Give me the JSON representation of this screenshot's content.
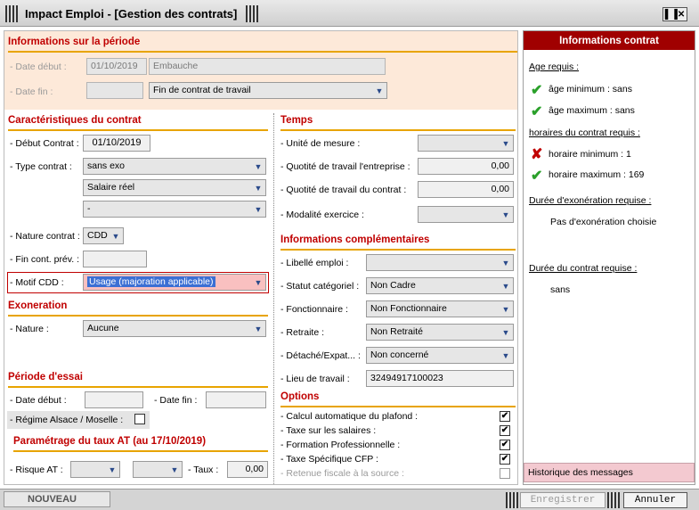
{
  "window": {
    "title": "Impact Emploi - [Gestion des contrats]"
  },
  "periode": {
    "title": "Informations sur la période",
    "date_debut_label": "- Date début :",
    "date_debut_value": "01/10/2019",
    "date_debut_reason": "Embauche",
    "date_fin_label": "- Date fin :",
    "date_fin_value": "",
    "date_fin_reason": "Fin de contrat de travail"
  },
  "caracteristiques": {
    "title": "Caractéristiques du contrat",
    "debut_label": "- Début Contrat :",
    "debut_value": "01/10/2019",
    "type_label": "- Type contrat :",
    "type_value": "sans exo",
    "type_value2": "Salaire réel",
    "type_value3": "-",
    "nature_label": "- Nature contrat :",
    "nature_value": "CDD",
    "fin_prev_label": "- Fin cont. prév. :",
    "fin_prev_value": "",
    "motif_label": "- Motif CDD :",
    "motif_value": "Usage (majoration applicable)"
  },
  "exoneration": {
    "title": "Exoneration",
    "nature_label": "- Nature :",
    "nature_value": "Aucune"
  },
  "essai": {
    "title": "Période d'essai",
    "debut_label": "- Date début :",
    "fin_label": "- Date fin :",
    "regime_label": "- Régime Alsace / Moselle :"
  },
  "taux_at": {
    "title": "Paramétrage du taux AT (au 17/10/2019)",
    "risque_label": "- Risque AT :",
    "taux_label": "- Taux :",
    "taux_value": "0,00"
  },
  "temps": {
    "title": "Temps",
    "unite_label": "- Unité de mesure :",
    "quotite_ent_label": "- Quotité de travail l'entreprise :",
    "quotite_ent_value": "0,00",
    "quotite_ctr_label": "- Quotité de travail du contrat :",
    "quotite_ctr_value": "0,00",
    "modalite_label": "- Modalité exercice :"
  },
  "complementaires": {
    "title": "Informations complémentaires",
    "libelle_label": "- Libellé emploi :",
    "statut_label": "- Statut catégoriel :",
    "statut_value": "Non Cadre",
    "fonctionnaire_label": "- Fonctionnaire :",
    "fonctionnaire_value": "Non Fonctionnaire",
    "retraite_label": "- Retraite :",
    "retraite_value": "Non Retraité",
    "detache_label": "- Détaché/Expat... :",
    "detache_value": "Non concerné",
    "lieu_label": "- Lieu de travail :",
    "lieu_value": "32494917100023"
  },
  "options": {
    "title": "Options",
    "items": [
      {
        "label": "- Calcul automatique du plafond  :",
        "checked": true
      },
      {
        "label": "- Taxe sur les salaires :",
        "checked": true
      },
      {
        "label": "- Formation Professionnelle :",
        "checked": true
      },
      {
        "label": "- Taxe Spécifique CFP :",
        "checked": true
      },
      {
        "label": "- Retenue fiscale à la source :",
        "checked": false
      }
    ]
  },
  "sidebar": {
    "title": "Informations contrat",
    "age_title": "Age requis :",
    "age_min": "âge minimum :  sans",
    "age_max": "âge maximum :  sans",
    "horaires_title": "horaires du contrat requis :",
    "horaire_min": "horaire minimum : 1",
    "horaire_max": "horaire maximum : 169",
    "exo_title": "Durée d'exonération requise :",
    "exo_value": "Pas d'exonération choisie",
    "duree_title": "Durée du contrat requise :",
    "duree_value": "sans",
    "historique": "Historique des messages"
  },
  "bottom": {
    "status": "NOUVEAU",
    "save_label": "Enregistrer",
    "cancel_label": "Annuler"
  },
  "colors": {
    "section_red": "#c00000",
    "underline_orange": "#e8a400",
    "header_red": "#a00000",
    "period_bg": "#fde9d9",
    "motif_bg": "#f9c0c0",
    "motif_selected": "#3b6fd4"
  }
}
